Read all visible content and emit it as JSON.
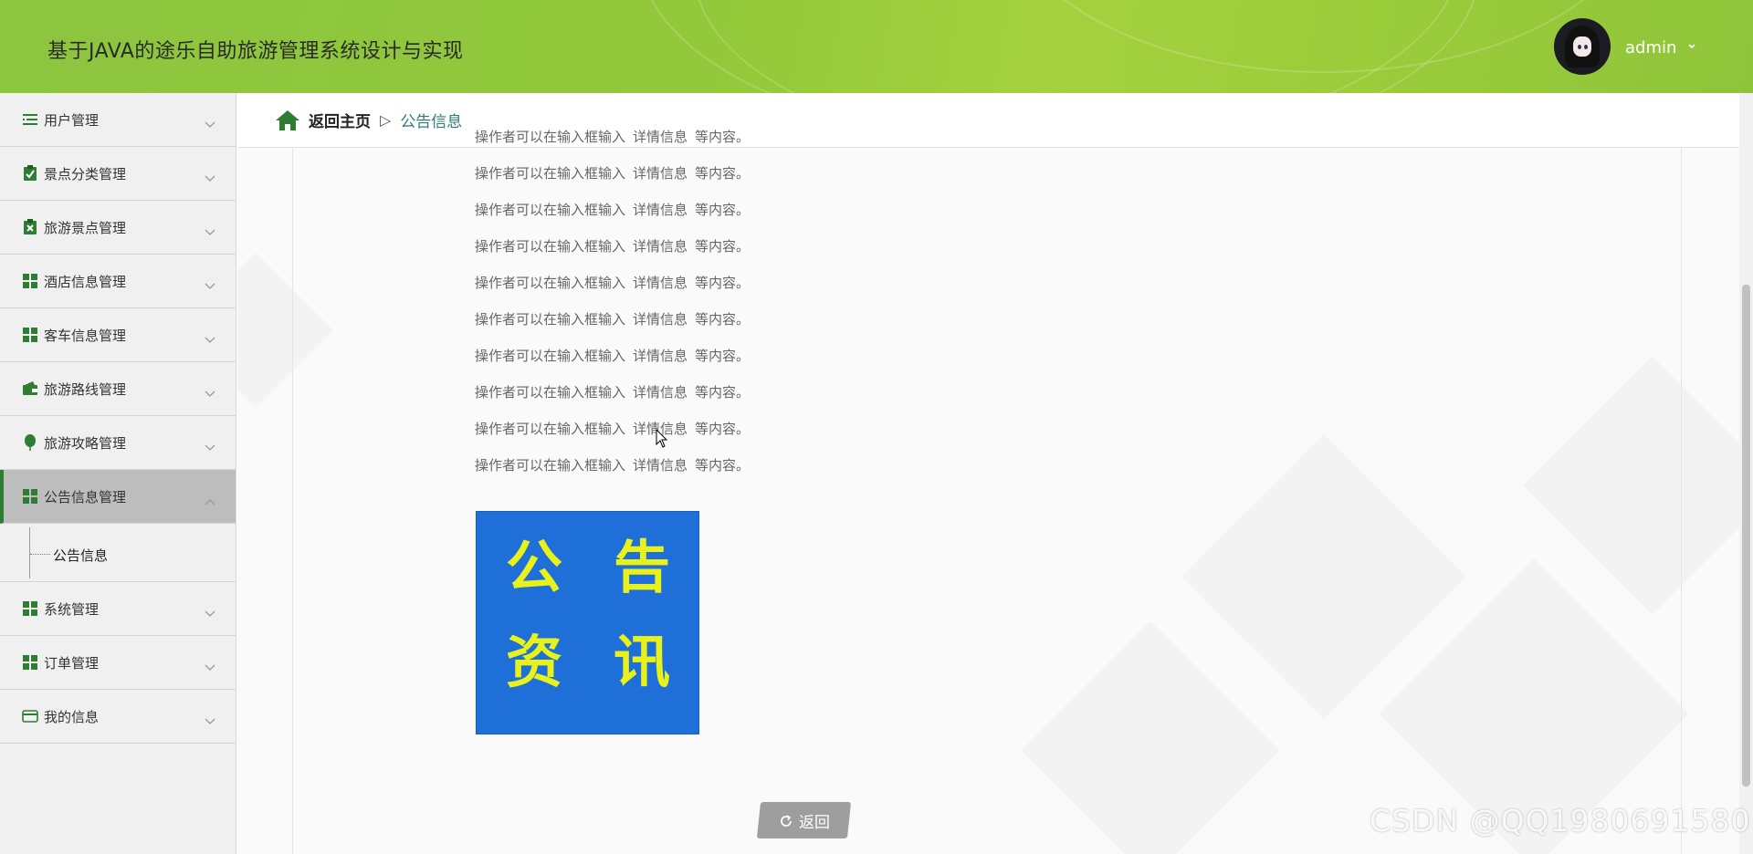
{
  "header": {
    "title": "基于JAVA的途乐自助旅游管理系统设计与实现",
    "user_name": "admin"
  },
  "sidebar": {
    "items": [
      {
        "label": "用户管理",
        "icon": "list-icon"
      },
      {
        "label": "景点分类管理",
        "icon": "clipboard-check-icon"
      },
      {
        "label": "旅游景点管理",
        "icon": "clipboard-x-icon"
      },
      {
        "label": "酒店信息管理",
        "icon": "grid-icon"
      },
      {
        "label": "客车信息管理",
        "icon": "grid-icon"
      },
      {
        "label": "旅游路线管理",
        "icon": "wallet-icon"
      },
      {
        "label": "旅游攻略管理",
        "icon": "balloon-icon"
      },
      {
        "label": "公告信息管理",
        "icon": "grid-icon",
        "active": true
      },
      {
        "label": "系统管理",
        "icon": "grid-icon"
      },
      {
        "label": "订单管理",
        "icon": "grid-icon"
      },
      {
        "label": "我的信息",
        "icon": "card-icon"
      }
    ],
    "submenu": {
      "label": "公告信息"
    }
  },
  "breadcrumb": {
    "home": "返回主页",
    "separator": "▷",
    "current": "公告信息"
  },
  "content": {
    "lines": [
      {
        "a": "操作者可以在输入框输入",
        "b": "详情信息",
        "c": "等内容。"
      },
      {
        "a": "操作者可以在输入框输入",
        "b": "详情信息",
        "c": "等内容。"
      },
      {
        "a": "操作者可以在输入框输入",
        "b": "详情信息",
        "c": "等内容。"
      },
      {
        "a": "操作者可以在输入框输入",
        "b": "详情信息",
        "c": "等内容。"
      },
      {
        "a": "操作者可以在输入框输入",
        "b": "详情信息",
        "c": "等内容。"
      },
      {
        "a": "操作者可以在输入框输入",
        "b": "详情信息",
        "c": "等内容。"
      },
      {
        "a": "操作者可以在输入框输入",
        "b": "详情信息",
        "c": "等内容。"
      },
      {
        "a": "操作者可以在输入框输入",
        "b": "详情信息",
        "c": "等内容。"
      },
      {
        "a": "操作者可以在输入框输入",
        "b": "详情信息",
        "c": "等内容。"
      },
      {
        "a": "操作者可以在输入框输入",
        "b": "详情信息",
        "c": "等内容。"
      }
    ],
    "image_chars": [
      "公",
      "告",
      "资",
      "讯"
    ],
    "back_button": "返回"
  },
  "watermark": "CSDN @QQ1980691580",
  "colors": {
    "header_green": "#8cc63f",
    "icon_green": "#2e7d32",
    "notice_blue": "#1f6fd8",
    "notice_yellow": "#e8f21a",
    "button_gray": "#9e9e9e"
  }
}
